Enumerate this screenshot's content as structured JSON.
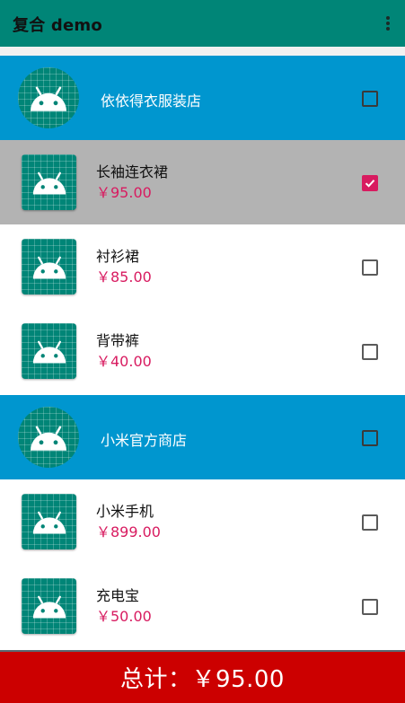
{
  "app": {
    "title": "复合 demo",
    "overflow_icon": "more-vert-icon"
  },
  "colors": {
    "appbar": "#008577",
    "store_row": "#0096cf",
    "selected_row": "#b3b3b3",
    "price": "#d81b60",
    "footer": "#cc0000"
  },
  "list": [
    {
      "kind": "store",
      "name": "依依得衣服装店",
      "checked": false,
      "icon": "android-icon"
    },
    {
      "kind": "item",
      "name": "长袖连衣裙",
      "price": "￥95.00",
      "checked": true,
      "selected": true,
      "icon": "android-icon"
    },
    {
      "kind": "item",
      "name": "衬衫裙",
      "price": "￥85.00",
      "checked": false,
      "selected": false,
      "icon": "android-icon"
    },
    {
      "kind": "item",
      "name": "背带裤",
      "price": "￥40.00",
      "checked": false,
      "selected": false,
      "icon": "android-icon"
    },
    {
      "kind": "store",
      "name": "小米官方商店",
      "checked": false,
      "icon": "android-icon"
    },
    {
      "kind": "item",
      "name": "小米手机",
      "price": "￥899.00",
      "checked": false,
      "selected": false,
      "icon": "android-icon"
    },
    {
      "kind": "item",
      "name": "充电宝",
      "price": "￥50.00",
      "checked": false,
      "selected": false,
      "icon": "android-icon"
    }
  ],
  "footer": {
    "total": "总计：￥95.00"
  }
}
